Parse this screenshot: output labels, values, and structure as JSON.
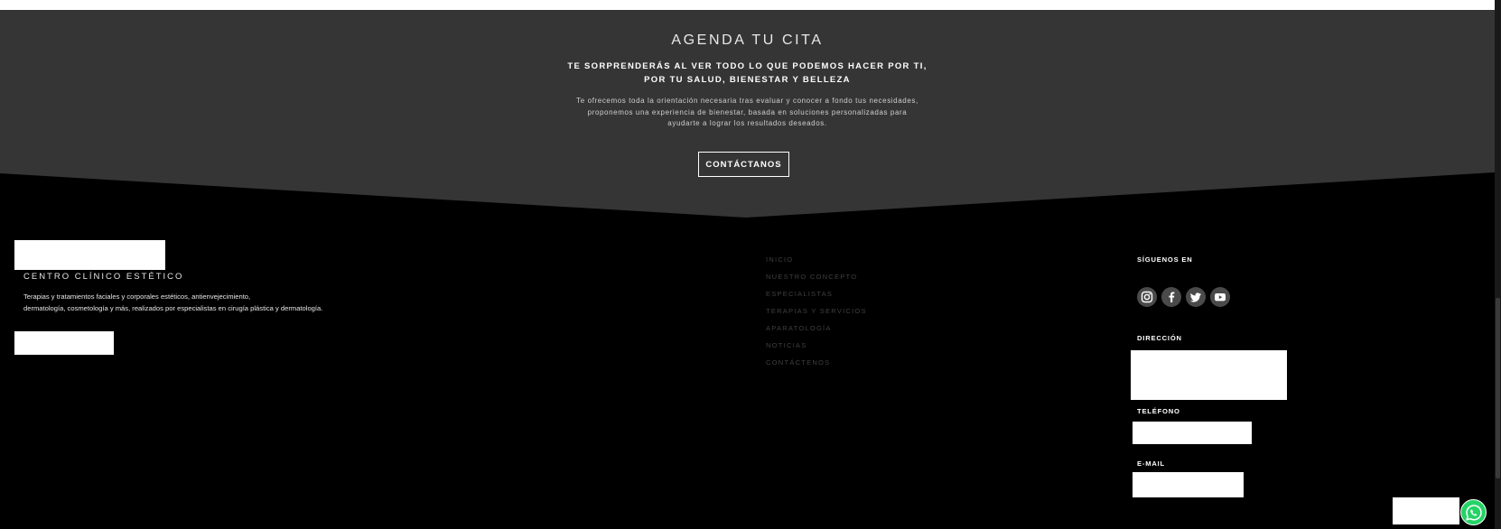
{
  "cta": {
    "title": "AGENDA TU CITA",
    "subtitle_line1": "TE SORPRENDERÁS AL VER TODO LO QUE PODEMOS HACER POR TI,",
    "subtitle_line2": "POR TU SALUD, BIENESTAR Y BELLEZA",
    "desc_line1": "Te ofrecemos toda la orientación necesaria tras evaluar y conocer a fondo tus necesidades,",
    "desc_line2": "proponemos una experiencia de bienestar, basada en soluciones personalizadas para",
    "desc_line3": "ayudarte a lograr los resultados deseados.",
    "button_label": "CONTÁCTANOS",
    "bg_color": "#353535"
  },
  "footer": {
    "tagline": "CENTRO CLÍNICO ESTÉTICO",
    "desc_line1": "Terapias y tratamientos faciales y corporales estéticos, antienvejecimiento,",
    "desc_line2": "dermatología, cosmetología y más, realizados por especialistas en cirugía plástica y dermatología.",
    "nav": [
      {
        "label": "INICIO"
      },
      {
        "label": "NUESTRO CONCEPTO"
      },
      {
        "label": "ESPECIALISTAS"
      },
      {
        "label": "TERAPIAS Y SERVICIOS"
      },
      {
        "label": "APARATOLOGÍA"
      },
      {
        "label": "NOTICIAS"
      },
      {
        "label": "CONTÁCTENOS"
      }
    ],
    "follow_heading": "SÍGUENOS EN",
    "social_icons": [
      "instagram-icon",
      "facebook-icon",
      "twitter-icon",
      "youtube-icon"
    ],
    "address_heading": "DIRECCIÓN",
    "phone_heading": "TELÉFONO",
    "email_heading": "E-MAIL",
    "bg_color": "#000000"
  },
  "whatsapp": {
    "icon": "whatsapp-icon",
    "color": "#25d366"
  }
}
